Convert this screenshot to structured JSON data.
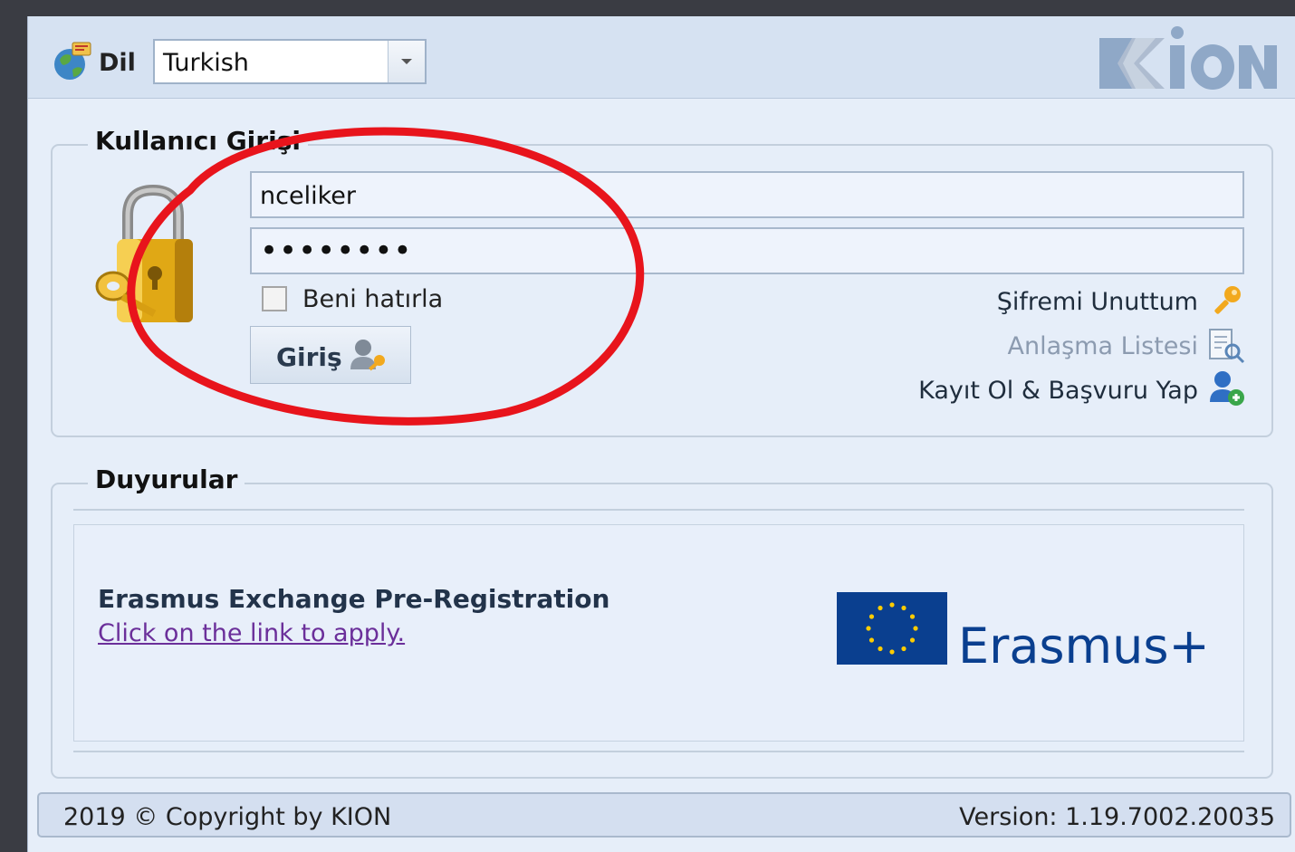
{
  "language": {
    "label": "Dil",
    "selected": "Turkish"
  },
  "login": {
    "legend": "Kullanıcı Girişi",
    "username_value": "nceliker",
    "password_value": "••••••••",
    "remember_label": "Beni hatırla",
    "remember_checked": false,
    "submit_label": "Giriş",
    "links": {
      "forgot_password": "Şifremi Unuttum",
      "agreement_list": "Anlaşma Listesi",
      "register": "Kayıt Ol & Başvuru Yap"
    }
  },
  "announcements": {
    "legend": "Duyurular",
    "title": "Erasmus Exchange Pre-Registration",
    "link_text": "Click on the link to apply.",
    "banner_text": "Erasmus+"
  },
  "footer": {
    "copyright": "2019 © Copyright by KION",
    "version": "Version: 1.19.7002.20035"
  },
  "colors": {
    "panel_bg": "#e6eef9",
    "header_bg": "#d6e2f2",
    "link_visited": "#6b2f9a",
    "eu_blue": "#0a3f8f",
    "eu_star": "#ffcc00",
    "annotation_red": "#e8141c"
  },
  "icons": {
    "language": "globe-flag-icon",
    "login_lock": "padlock-key-icon",
    "submit": "user-key-icon",
    "forgot": "key-icon",
    "agreement": "document-search-icon",
    "register": "user-add-icon"
  }
}
